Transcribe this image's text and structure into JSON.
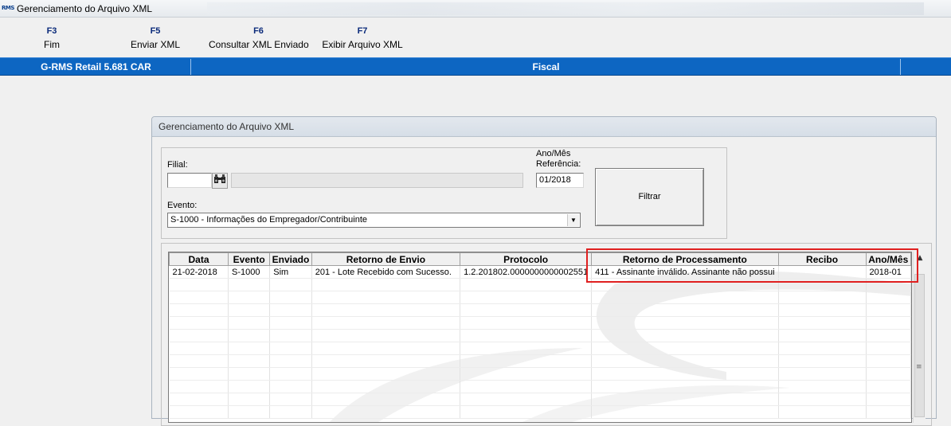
{
  "window": {
    "icon_text": "RMS",
    "title": "Gerenciamento do Arquivo XML"
  },
  "toolbar": [
    {
      "key": "F3",
      "label": "Fim"
    },
    {
      "key": "F5",
      "label": "Enviar XML"
    },
    {
      "key": "F6",
      "label": "Consultar XML Enviado"
    },
    {
      "key": "F7",
      "label": "Exibir Arquivo XML"
    }
  ],
  "infobar": {
    "system": "G-RMS Retail 5.681 CAR",
    "module": "Fiscal"
  },
  "form": {
    "title": "Gerenciamento do Arquivo XML",
    "filial_label": "Filial:",
    "filial_value": "",
    "filial_desc": "",
    "ano_mes_label_1": "Ano/Mês",
    "ano_mes_label_2": "Referência:",
    "ano_mes_value": "01/2018",
    "evento_label": "Evento:",
    "evento_value": "S-1000 - Informações do Empregador/Contribuinte",
    "filtrar_label": "Filtrar"
  },
  "grid": {
    "columns": [
      "Data",
      "Evento",
      "Enviado",
      "Retorno de Envio",
      "Protocolo",
      "Retorno de Processamento",
      "Recibo",
      "Ano/Mês"
    ],
    "rows": [
      [
        "21-02-2018",
        "S-1000",
        "Sim",
        "201 - Lote Recebido com Sucesso.",
        "1.2.201802.0000000000002551",
        "411 - Assinante inválido. Assinante não possui",
        "",
        "2018-01"
      ]
    ],
    "empty_rows": 11
  },
  "colors": {
    "infobar": "#0d66c2",
    "highlight": "#e02020",
    "fkey": "#0a2a7a"
  }
}
